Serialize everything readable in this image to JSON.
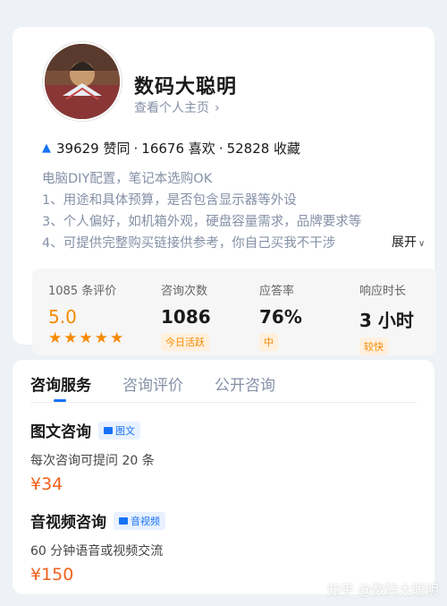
{
  "profile": {
    "name": "数码大聪明",
    "homepage_link": "查看个人主页",
    "stats": {
      "approvals": "39629 赞同",
      "likes": "16676 喜欢",
      "collections": "52828 收藏"
    },
    "description": [
      "电脑DIY配置，笔记本选购OK",
      "1、用途和具体预算，是否包含显示器等外设",
      "3、个人偏好，如机箱外观，硬盘容量需求，品牌要求等",
      "4、可提供完整购买链接供参考，你自己买我不干涉"
    ],
    "expand_label": "展开"
  },
  "metrics": [
    {
      "label": "1085 条评价",
      "value": "5.0",
      "stars": 5
    },
    {
      "label": "咨询次数",
      "value": "1086",
      "badge": "今日活跃"
    },
    {
      "label": "应答率",
      "value": "76%",
      "badge": "中"
    },
    {
      "label": "响应时长",
      "value": "3 小时",
      "badge": "较快"
    }
  ],
  "tabs": [
    "咨询服务",
    "咨询评价",
    "公开咨询"
  ],
  "services": [
    {
      "title": "图文咨询",
      "badge": "图文",
      "desc": "每次咨询可提问 20 条",
      "price": "¥34"
    },
    {
      "title": "音视频咨询",
      "badge": "音视频",
      "desc": "60 分钟语音或视频交流",
      "price": "¥150"
    }
  ],
  "watermark": "知乎 @数码大聪明",
  "colors": {
    "accent": "#1772f6",
    "orange": "#f58a00",
    "price": "#f0611c"
  }
}
